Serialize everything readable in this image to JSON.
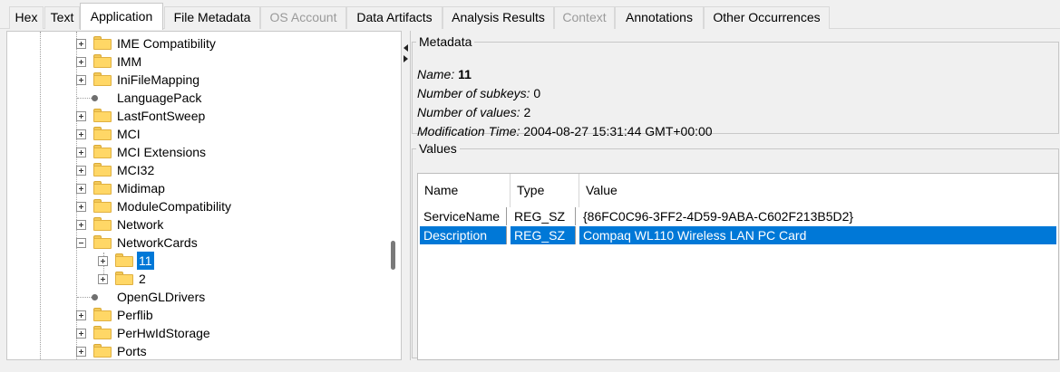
{
  "tabs": [
    {
      "label": "Hex",
      "state": "normal"
    },
    {
      "label": "Text",
      "state": "normal"
    },
    {
      "label": "Application",
      "state": "active"
    },
    {
      "label": "File Metadata",
      "state": "normal"
    },
    {
      "label": "OS Account",
      "state": "disabled"
    },
    {
      "label": "Data Artifacts",
      "state": "normal"
    },
    {
      "label": "Analysis Results",
      "state": "normal"
    },
    {
      "label": "Context",
      "state": "disabled"
    },
    {
      "label": "Annotations",
      "state": "normal"
    },
    {
      "label": "Other Occurrences",
      "state": "normal"
    }
  ],
  "tree": {
    "items": [
      {
        "label": "IME Compatibility",
        "type": "folder",
        "expander": "plus"
      },
      {
        "label": "IMM",
        "type": "folder",
        "expander": "plus"
      },
      {
        "label": "IniFileMapping",
        "type": "folder",
        "expander": "plus"
      },
      {
        "label": "LanguagePack",
        "type": "leaf",
        "expander": "none"
      },
      {
        "label": "LastFontSweep",
        "type": "folder",
        "expander": "plus"
      },
      {
        "label": "MCI",
        "type": "folder",
        "expander": "plus"
      },
      {
        "label": "MCI Extensions",
        "type": "folder",
        "expander": "plus"
      },
      {
        "label": "MCI32",
        "type": "folder",
        "expander": "plus"
      },
      {
        "label": "Midimap",
        "type": "folder",
        "expander": "plus"
      },
      {
        "label": "ModuleCompatibility",
        "type": "folder",
        "expander": "plus"
      },
      {
        "label": "Network",
        "type": "folder",
        "expander": "plus"
      },
      {
        "label": "NetworkCards",
        "type": "folder",
        "expander": "minus"
      },
      {
        "label": "11",
        "type": "folder",
        "expander": "plus",
        "child": true,
        "selected": true
      },
      {
        "label": "2",
        "type": "folder",
        "expander": "plus",
        "child": true
      },
      {
        "label": "OpenGLDrivers",
        "type": "leaf",
        "expander": "none"
      },
      {
        "label": "Perflib",
        "type": "folder",
        "expander": "plus"
      },
      {
        "label": "PerHwIdStorage",
        "type": "folder",
        "expander": "plus"
      },
      {
        "label": "Ports",
        "type": "folder",
        "expander": "plus"
      }
    ]
  },
  "metadata": {
    "legend": "Metadata",
    "name_label": "Name:",
    "name_value": "11",
    "subkeys_label": "Number of subkeys:",
    "subkeys_value": "0",
    "values_label": "Number of values:",
    "values_value": "2",
    "modtime_label": "Modification Time:",
    "modtime_value": "2004-08-27 15:31:44 GMT+00:00"
  },
  "values": {
    "legend": "Values",
    "columns": [
      "Name",
      "Type",
      "Value"
    ],
    "rows": [
      {
        "name": "ServiceName",
        "type": "REG_SZ",
        "value": "{86FC0C96-3FF2-4D59-9ABA-C602F213B5D2}",
        "selected": false
      },
      {
        "name": "Description",
        "type": "REG_SZ",
        "value": "Compaq WL110 Wireless LAN PC Card",
        "selected": true
      }
    ]
  },
  "colors": {
    "selection": "#0078d7",
    "folder": "#ffd766",
    "disabled_text": "#9a9a9a"
  }
}
